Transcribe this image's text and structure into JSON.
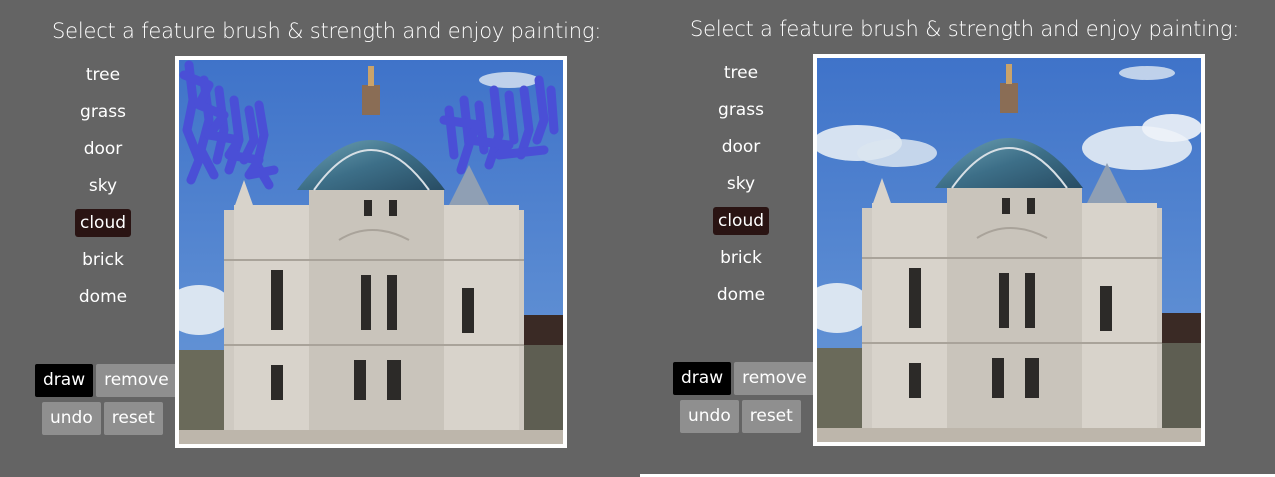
{
  "panels": [
    {
      "title": "Select a feature brush & strength and enjoy painting:",
      "features": [
        "tree",
        "grass",
        "door",
        "sky",
        "cloud",
        "brick",
        "dome"
      ],
      "active_feature": "cloud",
      "buttons": {
        "draw": "draw",
        "remove": "remove",
        "undo": "undo",
        "reset": "reset"
      },
      "active_mode": "draw",
      "has_brush_strokes": true
    },
    {
      "title": "Select a feature brush & strength and enjoy painting:",
      "features": [
        "tree",
        "grass",
        "door",
        "sky",
        "cloud",
        "brick",
        "dome"
      ],
      "active_feature": "cloud",
      "buttons": {
        "draw": "draw",
        "remove": "remove",
        "undo": "undo",
        "reset": "reset"
      },
      "active_mode": "draw",
      "has_brush_strokes": false
    }
  ],
  "colors": {
    "background": "#646464",
    "active_feature_bg": "#2a1413",
    "active_button_bg": "#000000",
    "button_bg": "#8f8f8f",
    "brush_stroke": "#4a4fd6",
    "sky": "#4d7fd0"
  }
}
